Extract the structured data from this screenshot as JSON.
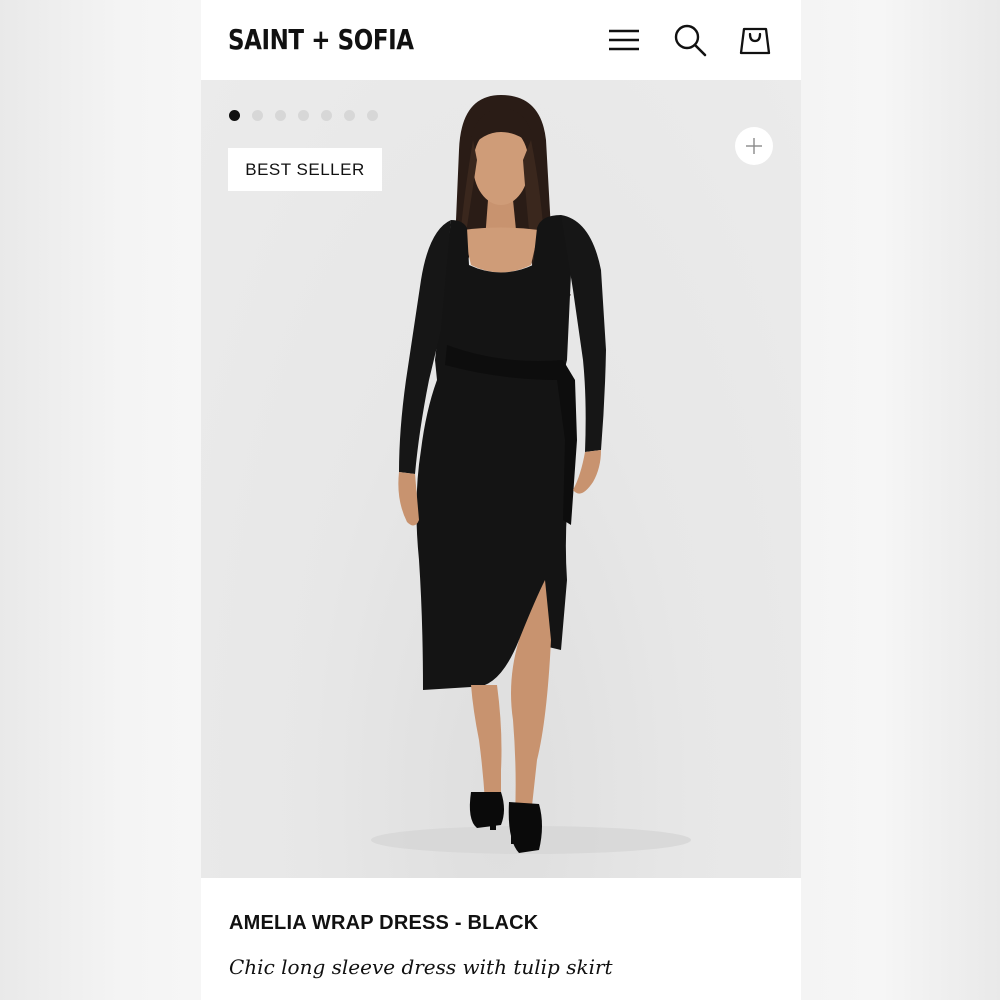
{
  "header": {
    "brand": "SAINT + SOFIA",
    "icons": [
      "menu-icon",
      "search-icon",
      "shopping-bag-icon"
    ]
  },
  "gallery": {
    "image_count": 7,
    "active_index": 0,
    "badge": "BEST SELLER",
    "zoom_icon": "plus-icon",
    "image_subject": "model wearing long sleeve black wrap dress with black heeled mules"
  },
  "product": {
    "name": "AMELIA WRAP DRESS - BLACK",
    "description": "Chic long sleeve dress with tulip skirt"
  },
  "colors": {
    "text": "#111111",
    "gallery_bg": "#ebebeb",
    "dot_inactive": "#d7d7d7",
    "dot_active": "#111111"
  }
}
